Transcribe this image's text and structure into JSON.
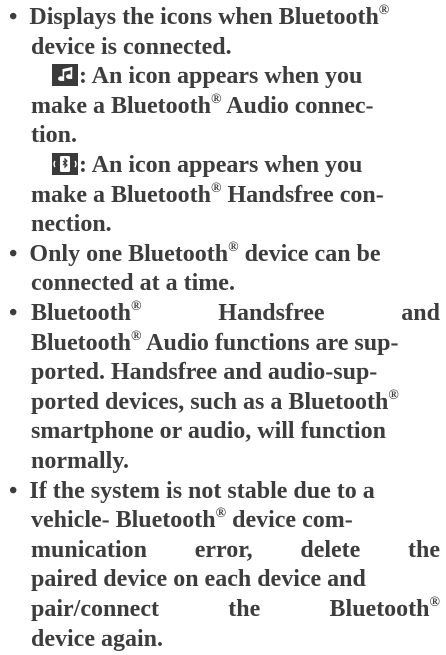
{
  "bullet_glyph": "•",
  "reg_mark": "®",
  "items": [
    {
      "line1_a": "Displays the icons when Bluetooth",
      "line2": "device is connected.",
      "audio_text": ": An icon appears when you",
      "audio_line2_a": "make a Bluetooth",
      "audio_line2_b": " Audio connec-",
      "audio_line3": "tion.",
      "handsfree_text": ": An icon appears when you",
      "handsfree_line2_a": "make a Bluetooth",
      "handsfree_line2_b": " Handsfree con-",
      "handsfree_line3": "nection."
    },
    {
      "line1_a": "Only one Bluetooth",
      "line1_b": " device can be",
      "line2": "connected at a time."
    },
    {
      "line1_words": [
        "Bluetooth",
        "Handsfree",
        "and"
      ],
      "line2_a": "Bluetooth",
      "line2_b": " Audio functions are sup-",
      "line3": "ported. Handsfree and audio-sup-",
      "line4_a": "ported devices, such as a Bluetooth",
      "line5": "smartphone or audio, will function",
      "line6": "normally."
    },
    {
      "line1": "If the system is not stable due to a",
      "line2_a": "vehicle- Bluetooth",
      "line2_b": " device com-",
      "line3_words": [
        "munication",
        "error,",
        "delete",
        "the"
      ],
      "line4": "paired device on each device and",
      "line5_words": [
        "pair/connect",
        "the",
        "Bluetooth"
      ],
      "line6": "device again."
    }
  ],
  "icons": {
    "audio": "music-note-icon",
    "handsfree": "bluetooth-phone-icon"
  }
}
